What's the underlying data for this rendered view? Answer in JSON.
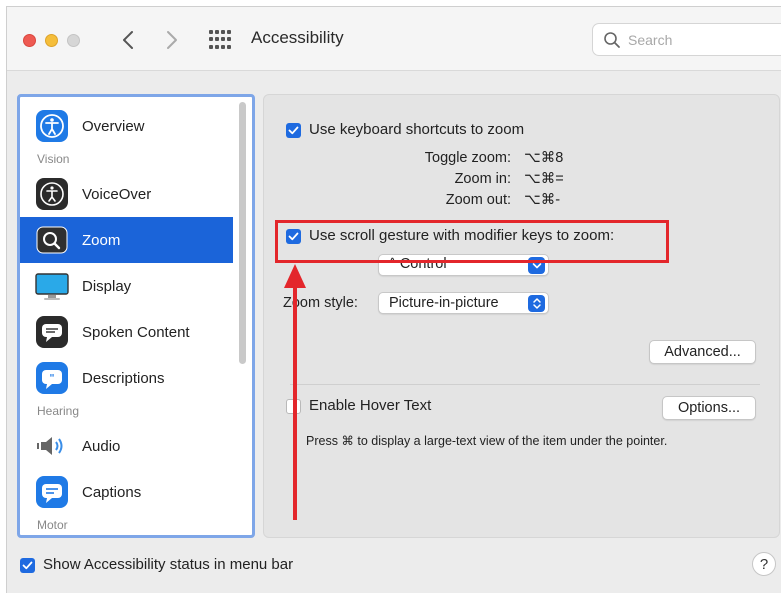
{
  "window": {
    "title": "Accessibility",
    "search_placeholder": "Search"
  },
  "sidebar": {
    "items": [
      {
        "label": "Overview",
        "icon": "accessibility-icon"
      },
      {
        "label": "VoiceOver",
        "icon": "voiceover-icon"
      },
      {
        "label": "Zoom",
        "icon": "zoom-icon",
        "selected": true
      },
      {
        "label": "Display",
        "icon": "display-icon"
      },
      {
        "label": "Spoken Content",
        "icon": "speech-bubble-icon"
      },
      {
        "label": "Descriptions",
        "icon": "descriptions-icon"
      },
      {
        "label": "Audio",
        "icon": "speaker-icon"
      },
      {
        "label": "Captions",
        "icon": "captions-icon"
      }
    ],
    "sections": [
      "Vision",
      "Hearing",
      "Motor"
    ]
  },
  "main": {
    "keyboard_shortcuts": {
      "label": "Use keyboard shortcuts to zoom",
      "checked": true
    },
    "shortcuts": [
      {
        "label": "Toggle zoom:",
        "keys": "⌥⌘8"
      },
      {
        "label": "Zoom in:",
        "keys": "⌥⌘="
      },
      {
        "label": "Zoom out:",
        "keys": "⌥⌘-"
      }
    ],
    "scroll_gesture": {
      "label": "Use scroll gesture with modifier keys to zoom:",
      "checked": true
    },
    "modifier_select": {
      "value": "^ Control"
    },
    "zoom_style": {
      "label": "Zoom style:",
      "value": "Picture-in-picture"
    },
    "advanced_button": "Advanced...",
    "hover_text": {
      "label": "Enable Hover Text",
      "checked": false,
      "options_button": "Options...",
      "description": "Press ⌘ to display a large-text view of the item under the pointer."
    }
  },
  "footer": {
    "status_checkbox": {
      "label": "Show Accessibility status in menu bar",
      "checked": true
    },
    "help_label": "?"
  },
  "colors": {
    "accent": "#1e6ae0",
    "selection": "#1b64d9",
    "annotation": "#e3262b"
  }
}
